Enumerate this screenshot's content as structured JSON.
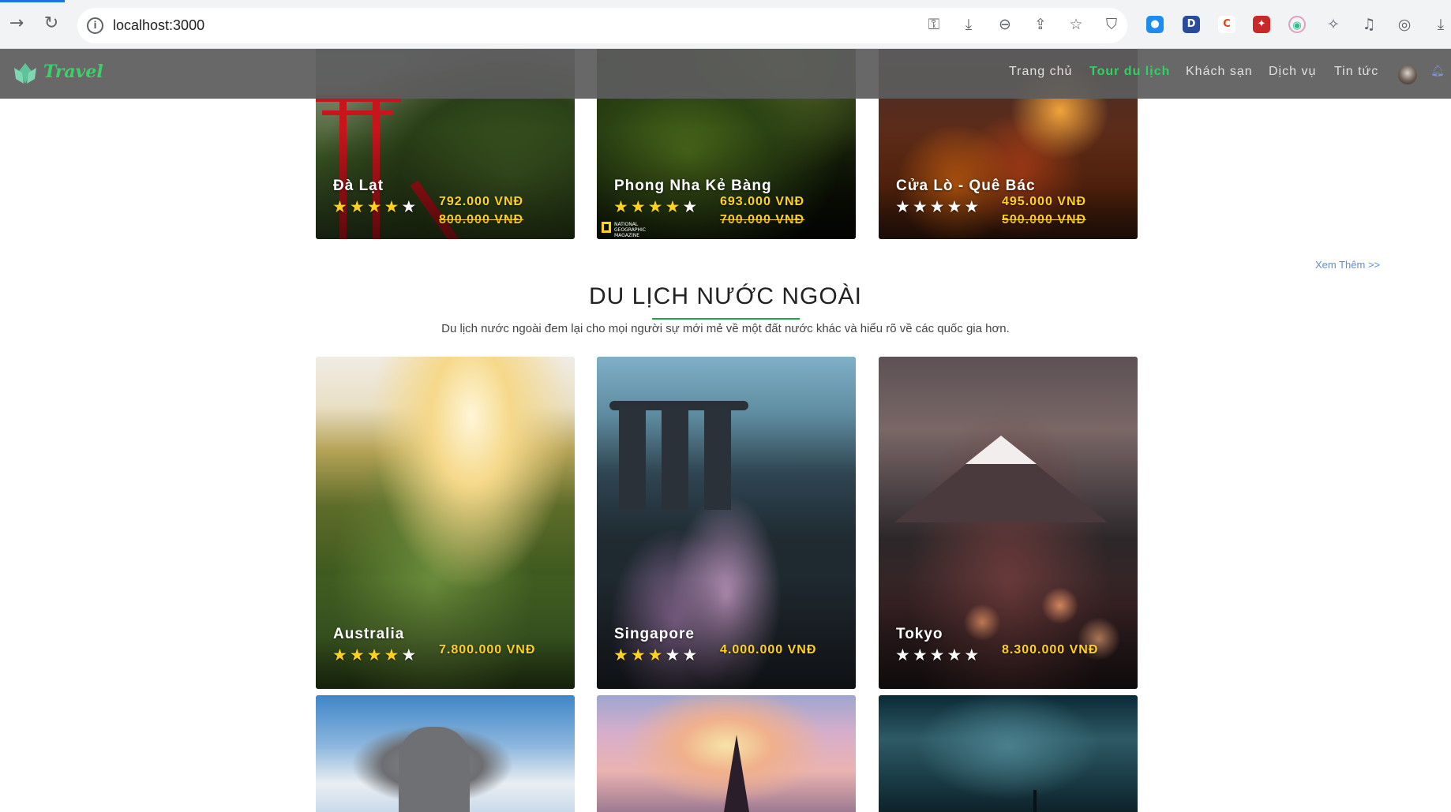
{
  "browser": {
    "url": "localhost:3000"
  },
  "navbar": {
    "logo_text": "Travel",
    "menu": [
      {
        "label": "Trang chủ",
        "active": false
      },
      {
        "label": "Tour du lịch",
        "active": true
      },
      {
        "label": "Khách sạn",
        "active": false
      },
      {
        "label": "Dịch vụ",
        "active": false
      },
      {
        "label": "Tin tức",
        "active": false
      }
    ]
  },
  "domestic": {
    "cards": [
      {
        "name": "Đà Lạt",
        "rating": 4,
        "price": "792.000 VNĐ",
        "old_price": "800.000 VNĐ"
      },
      {
        "name": "Phong Nha Kẻ Bàng",
        "rating": 4,
        "price": "693.000 VNĐ",
        "old_price": "700.000 VNĐ"
      },
      {
        "name": "Cửa Lò - Quê Bác",
        "rating": 0,
        "price": "495.000 VNĐ",
        "old_price": "500.000 VNĐ"
      }
    ],
    "see_more": "Xem Thêm >>"
  },
  "foreign": {
    "title": "DU LỊCH NƯỚC NGOÀI",
    "description": "Du lịch nước ngoài đem lại cho mọi người sự mới mẻ về một đất nước khác và hiểu rõ về các quốc gia hơn.",
    "cards": [
      {
        "name": "Australia",
        "rating": 4,
        "price": "7.800.000 VNĐ"
      },
      {
        "name": "Singapore",
        "rating": 3,
        "price": "4.000.000 VNĐ"
      },
      {
        "name": "Tokyo",
        "rating": 0,
        "price": "8.300.000 VNĐ"
      }
    ]
  },
  "colors": {
    "accent_green": "#2ed162",
    "price_yellow": "#ffd21f",
    "link_blue": "#5a8fd8"
  }
}
